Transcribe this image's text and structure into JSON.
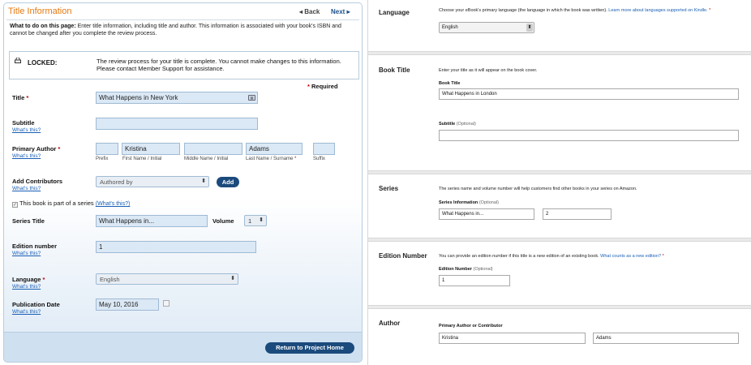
{
  "left": {
    "title": "Title Information",
    "nav": {
      "back": "◂ Back",
      "next": "Next ▸"
    },
    "instructions_heading": "What to do on this page:",
    "instructions_text": " Enter title information, including title and author. This information is associated with your book's ISBN and cannot be changed after you complete the review process.",
    "locked": {
      "label": "LOCKED:",
      "text": "The review process for your title is complete. You cannot make changes to this information. Please contact Member Support for assistance."
    },
    "required_note": "Required",
    "whats_this": "What's this?",
    "fields": {
      "title_label": "Title",
      "title_value": "What Happens in New York",
      "subtitle_label": "Subtitle",
      "subtitle_value": "",
      "primary_author_label": "Primary Author",
      "author_prefix": "",
      "author_first": "Kristina",
      "author_middle": "",
      "author_last": "Adams",
      "author_suffix": "",
      "cap_prefix": "Prefix",
      "cap_first": "First Name / Initial",
      "cap_middle": "Middle Name / Initial",
      "cap_last": "Last Name / Surname",
      "cap_suffix": "Suffix",
      "contributors_label": "Add Contributors",
      "contributors_select": "Authored by",
      "add_button": "Add",
      "series_checkbox_text": "This book is part of a series",
      "series_whats_this": "(What's this?)",
      "series_title_label": "Series Title",
      "series_title_value": "What Happens in...",
      "volume_label": "Volume",
      "volume_value": "1",
      "edition_label": "Edition number",
      "edition_value": "1",
      "language_label": "Language",
      "language_value": "English",
      "pubdate_label": "Publication Date",
      "pubdate_value": "May 10, 2016"
    },
    "return_button": "Return to Project Home"
  },
  "right": {
    "language": {
      "label": "Language",
      "desc": "Choose your eBook's primary language (the language in which the book was written).",
      "link": "Learn more about languages supported on Kindle.",
      "value": "English"
    },
    "book_title": {
      "label": "Book Title",
      "desc": "Enter your title as it will appear on the book cover.",
      "title_sub": "Book Title",
      "title_value": "What Happens in London",
      "subtitle_sub": "Subtitle",
      "subtitle_opt": "(Optional)",
      "subtitle_value": ""
    },
    "series": {
      "label": "Series",
      "desc": "The series name and volume number will help customers find other books in your series on Amazon.",
      "sub": "Series Information",
      "opt": "(Optional)",
      "name_value": "What Happens in...",
      "volume_value": "2"
    },
    "edition": {
      "label": "Edition Number",
      "desc": "You can provide an edition number if this title is a new edition of an existing book.",
      "link": "What counts as a new edition?",
      "sub": "Edition Number",
      "opt": "(Optional)",
      "value": "1"
    },
    "author": {
      "label": "Author",
      "sub": "Primary Author or Contributor",
      "first_value": "Kristina",
      "last_value": "Adams"
    }
  }
}
